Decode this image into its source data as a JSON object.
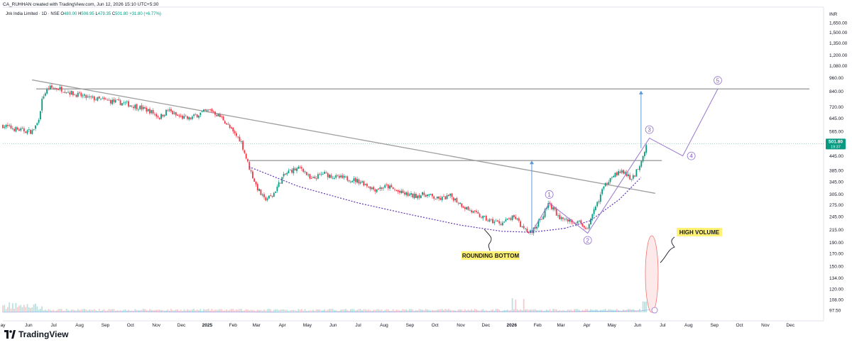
{
  "header": {
    "author_line": "CA_RUHHAN created with TradingView.com, Jun 12, 2026 15:10 UTC+5:30",
    "legend_name": "Jnk India Limited · 1D · NSE",
    "o_label": "O",
    "o_value": "480.00",
    "h_label": "H",
    "h_value": "506.95",
    "l_label": "L",
    "l_value": "479.35",
    "c_label": "C",
    "c_value": "501.80",
    "change": "+31.80 (+6.77%)"
  },
  "brand": {
    "text": "TradingView"
  },
  "colors": {
    "up": "#089981",
    "down": "#f23645",
    "trendline": "#9e9e9e",
    "dotted_curve": "#5e35b1",
    "wave": "#9575cd",
    "arrow": "#5b9bd5",
    "highlight": "#fff176",
    "volume_ellipse": "#ef5350",
    "price_tag": "#089981"
  },
  "chart_data": {
    "type": "candlestick",
    "title": "Jnk India Limited · 1D · NSE",
    "y_axis_unit": "INR",
    "y_scale": "log",
    "y_ticks": [
      "1,650.00",
      "1,500.00",
      "1,350.00",
      "1,200.00",
      "1,080.00",
      "960.00",
      "840.00",
      "720.00",
      "645.00",
      "565.00",
      "445.00",
      "385.00",
      "345.00",
      "305.00",
      "275.00",
      "245.00",
      "215.00",
      "190.00",
      "170.00",
      "150.00",
      "134.00",
      "120.00",
      "108.00",
      "97.50"
    ],
    "y_tick_values": [
      1650,
      1500,
      1350,
      1200,
      1080,
      960,
      840,
      720,
      645,
      565,
      445,
      385,
      345,
      305,
      275,
      245,
      215,
      190,
      170,
      150,
      134,
      120,
      108,
      97.5
    ],
    "x_ticks": [
      "ay",
      "Jun",
      "Jul",
      "Aug",
      "Sep",
      "Oct",
      "Nov",
      "Dec",
      "2025",
      "Feb",
      "Mar",
      "Apr",
      "May",
      "Jun",
      "Jul",
      "Aug",
      "Sep",
      "Oct",
      "Nov",
      "Dec",
      "2026",
      "Feb",
      "Mar",
      "Apr",
      "May",
      "Jun",
      "Jul",
      "Aug",
      "Sep",
      "Oct",
      "Nov",
      "Dec"
    ],
    "x_tick_dates": [
      "2024-05",
      "2024-06",
      "2024-07",
      "2024-08",
      "2024-09",
      "2024-10",
      "2024-11",
      "2024-12",
      "2025-01",
      "2025-02",
      "2025-03",
      "2025-04",
      "2025-05",
      "2025-06",
      "2025-07",
      "2025-08",
      "2025-09",
      "2025-10",
      "2025-11",
      "2025-12",
      "2026-01",
      "2026-02",
      "2026-03",
      "2026-04",
      "2026-05",
      "2026-06",
      "2026-07",
      "2026-08",
      "2026-09",
      "2026-10",
      "2026-11",
      "2026-12"
    ],
    "last_price": "501.80",
    "countdown": "19:37",
    "price_path": [
      [
        "2024-05-01",
        600
      ],
      [
        "2024-05-20",
        575
      ],
      [
        "2024-06-05",
        565
      ],
      [
        "2024-06-12",
        620
      ],
      [
        "2024-06-18",
        800
      ],
      [
        "2024-06-25",
        870
      ],
      [
        "2024-07-10",
        860
      ],
      [
        "2024-07-25",
        820
      ],
      [
        "2024-08-10",
        790
      ],
      [
        "2024-08-25",
        775
      ],
      [
        "2024-09-10",
        760
      ],
      [
        "2024-09-25",
        745
      ],
      [
        "2024-10-10",
        720
      ],
      [
        "2024-10-25",
        690
      ],
      [
        "2024-11-05",
        650
      ],
      [
        "2024-11-15",
        700
      ],
      [
        "2024-11-25",
        660
      ],
      [
        "2024-12-10",
        640
      ],
      [
        "2024-12-25",
        680
      ],
      [
        "2025-01-05",
        700
      ],
      [
        "2025-01-20",
        640
      ],
      [
        "2025-02-01",
        560
      ],
      [
        "2025-02-10",
        520
      ],
      [
        "2025-02-20",
        400
      ],
      [
        "2025-03-01",
        330
      ],
      [
        "2025-03-10",
        290
      ],
      [
        "2025-03-20",
        300
      ],
      [
        "2025-04-01",
        360
      ],
      [
        "2025-04-10",
        385
      ],
      [
        "2025-04-25",
        395
      ],
      [
        "2025-05-05",
        350
      ],
      [
        "2025-05-20",
        375
      ],
      [
        "2025-06-05",
        360
      ],
      [
        "2025-06-20",
        355
      ],
      [
        "2025-07-05",
        345
      ],
      [
        "2025-07-20",
        320
      ],
      [
        "2025-08-05",
        330
      ],
      [
        "2025-08-20",
        310
      ],
      [
        "2025-09-05",
        300
      ],
      [
        "2025-09-20",
        305
      ],
      [
        "2025-10-05",
        290
      ],
      [
        "2025-10-20",
        300
      ],
      [
        "2025-11-05",
        270
      ],
      [
        "2025-11-20",
        250
      ],
      [
        "2025-12-05",
        235
      ],
      [
        "2025-12-20",
        230
      ],
      [
        "2026-01-05",
        245
      ],
      [
        "2026-01-15",
        215
      ],
      [
        "2026-01-25",
        210
      ],
      [
        "2026-02-05",
        240
      ],
      [
        "2026-02-15",
        280
      ],
      [
        "2026-02-25",
        245
      ],
      [
        "2026-03-10",
        235
      ],
      [
        "2026-03-25",
        230
      ],
      [
        "2026-04-02",
        215
      ],
      [
        "2026-04-10",
        260
      ],
      [
        "2026-04-20",
        320
      ],
      [
        "2026-05-01",
        370
      ],
      [
        "2026-05-15",
        380
      ],
      [
        "2026-05-25",
        350
      ],
      [
        "2026-06-05",
        420
      ],
      [
        "2026-06-12",
        501.8
      ]
    ],
    "horizontal_levels": [
      860,
      425
    ],
    "trendline": [
      [
        "2024-06-05",
        940
      ],
      [
        "2026-06-22",
        308
      ]
    ],
    "waves": {
      "points": [
        {
          "label": "1",
          "date": "2026-02-15",
          "price": 280
        },
        {
          "label": "2",
          "date": "2026-04-02",
          "price": 208
        },
        {
          "label": "3",
          "date": "2026-06-15",
          "price": 530
        },
        {
          "label": "4",
          "date": "2026-07-25",
          "price": 445
        },
        {
          "label": "5",
          "date": "2026-09-05",
          "price": 860
        }
      ]
    },
    "target_arrows": [
      {
        "date": "2026-01-25",
        "from": 210,
        "to": 425
      },
      {
        "date": "2026-06-05",
        "from": 480,
        "to": 845
      }
    ],
    "annotations": {
      "rounding_bottom": "ROUNDING BOTTOM",
      "high_volume": "HIGH VOLUME"
    }
  }
}
